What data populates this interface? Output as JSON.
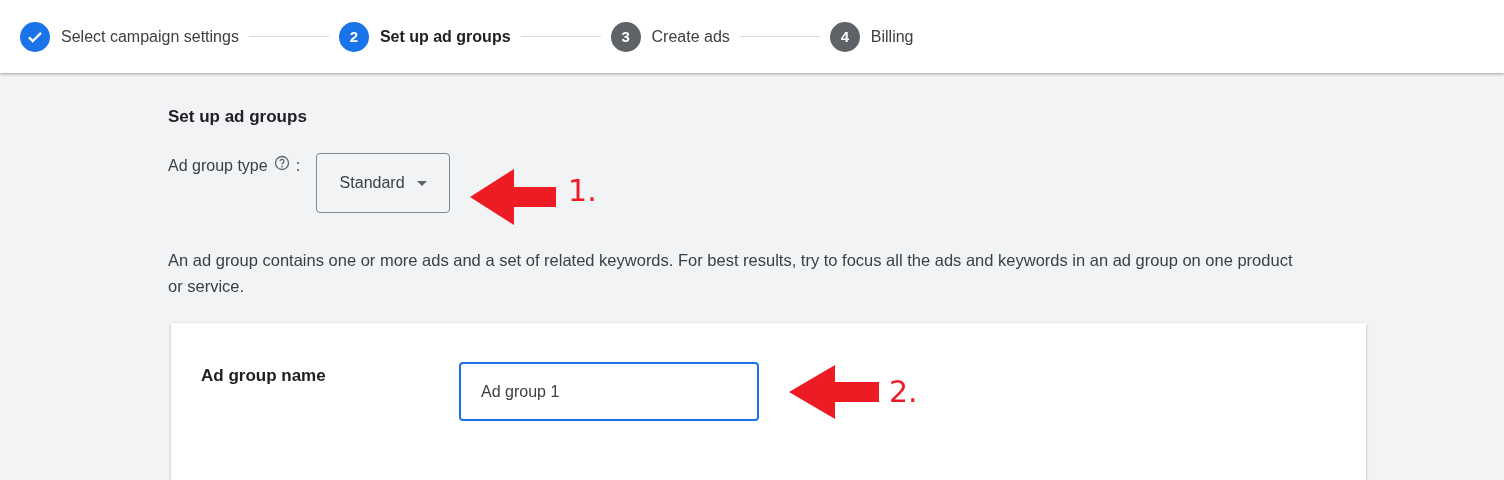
{
  "steps": [
    {
      "label": "Select campaign settings",
      "completed": true,
      "selected": false
    },
    {
      "number": "2",
      "label": "Set up ad groups",
      "completed": false,
      "selected": true
    },
    {
      "number": "3",
      "label": "Create ads",
      "completed": false,
      "selected": false
    },
    {
      "number": "4",
      "label": "Billing",
      "completed": false,
      "selected": false
    }
  ],
  "section_title": "Set up ad groups",
  "ad_group_type": {
    "label": "Ad group type",
    "separator": ":",
    "value": "Standard",
    "annotation": "1."
  },
  "description": "An ad group contains one or more ads and a set of related keywords. For best results, try to focus all the ads and keywords in an ad group on one product or service.",
  "card": {
    "label": "Ad group name",
    "value": "Ad group 1",
    "focused": true,
    "annotation": "2."
  }
}
